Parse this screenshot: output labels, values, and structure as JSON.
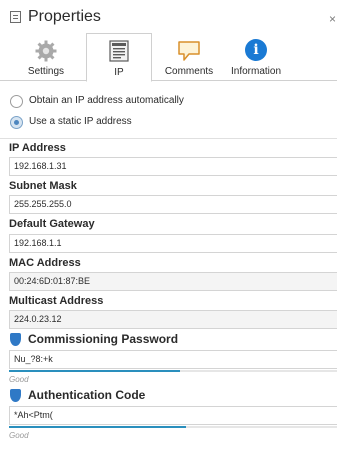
{
  "window": {
    "title": "Properties",
    "close_glyph": "×"
  },
  "tabs": [
    {
      "label": "Settings",
      "icon": "gear-icon"
    },
    {
      "label": "IP",
      "icon": "ip-settings-icon",
      "active": true
    },
    {
      "label": "Comments",
      "icon": "comment-icon"
    },
    {
      "label": "Information",
      "icon": "info-icon"
    }
  ],
  "ip_mode": {
    "options": [
      {
        "label": "Obtain an IP address automatically",
        "checked": false
      },
      {
        "label": "Use a static IP address",
        "checked": true
      }
    ]
  },
  "fields": {
    "ip_address": {
      "label": "IP Address",
      "value": "192.168.1.31"
    },
    "subnet_mask": {
      "label": "Subnet Mask",
      "value": "255.255.255.0"
    },
    "default_gateway": {
      "label": "Default Gateway",
      "value": "192.168.1.1"
    },
    "mac_address": {
      "label": "MAC Address",
      "value": "00:24:6D:01:87:BE"
    },
    "multicast_address": {
      "label": "Multicast Address",
      "value": "224.0.23.12"
    }
  },
  "commissioning_password": {
    "label": "Commissioning Password",
    "value": "Nu_?8:+k",
    "strength_label": "Good",
    "strength_fraction": 0.52
  },
  "authentication_code": {
    "label": "Authentication Code",
    "value": "*Ah<Ptm(",
    "strength_label": "Good",
    "strength_fraction": 0.54
  },
  "colors": {
    "accent": "#2f79c6",
    "strength": "#2a8fbd"
  }
}
